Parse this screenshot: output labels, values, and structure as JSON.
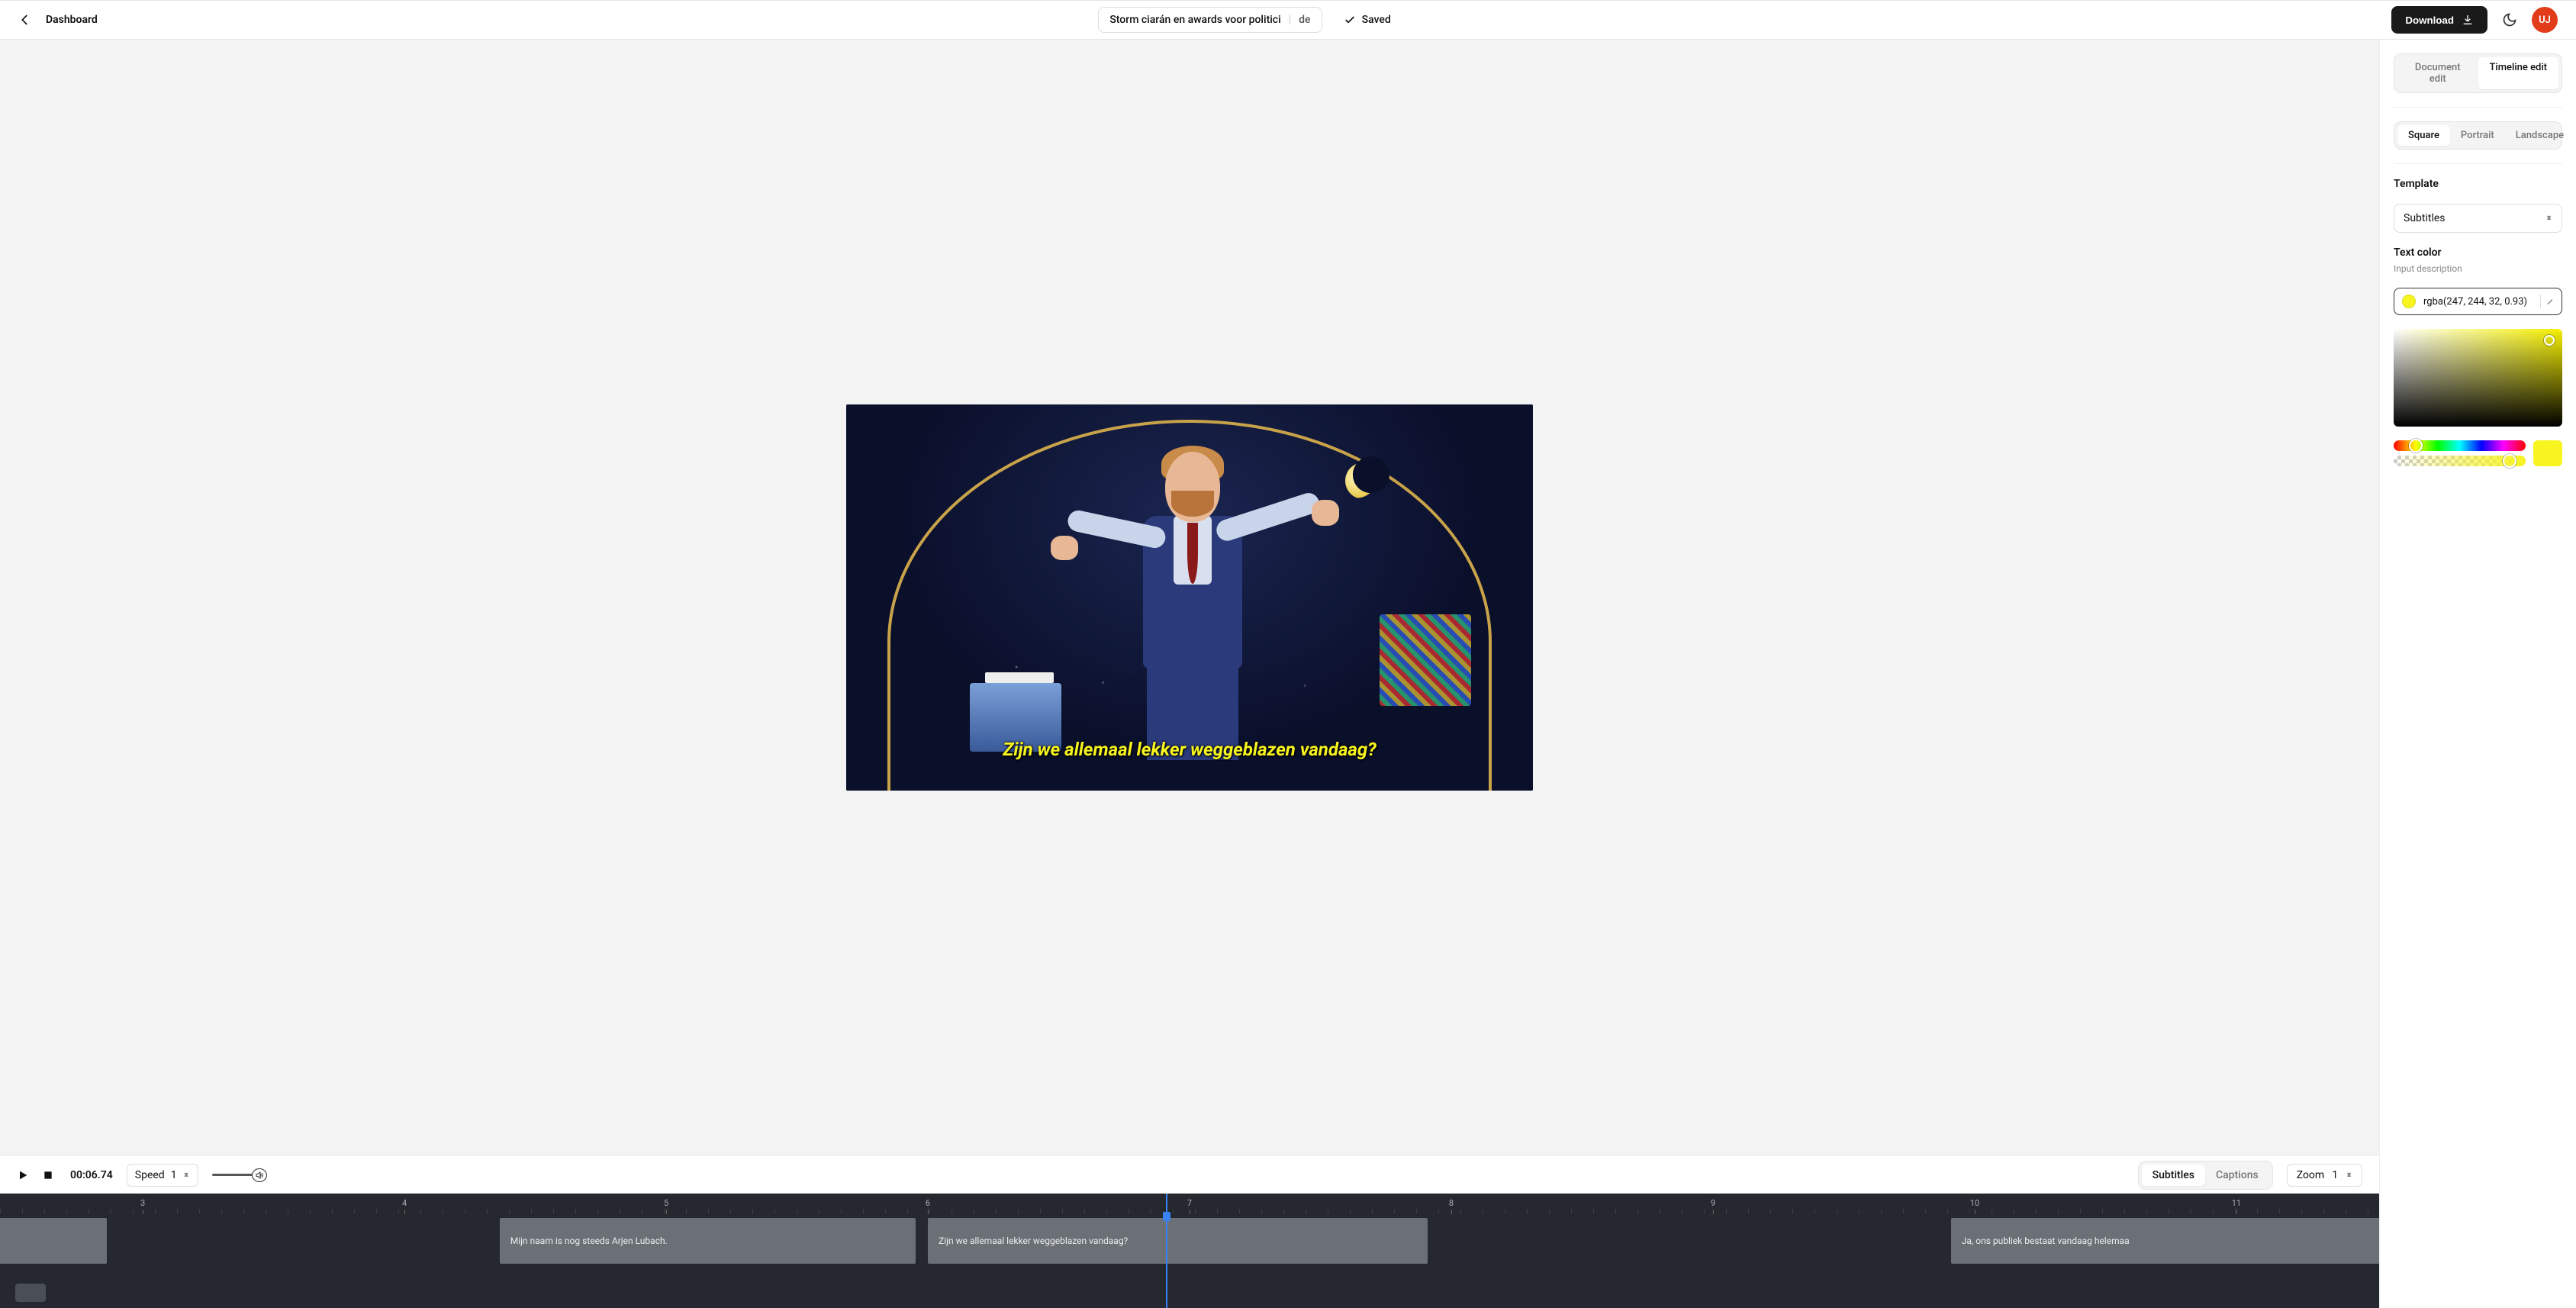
{
  "header": {
    "dashboard_label": "Dashboard",
    "project_title": "Storm ciarán en awards voor politici",
    "language": "de",
    "saved_label": "Saved",
    "download_label": "Download",
    "avatar_initials": "UJ"
  },
  "preview": {
    "subtitle_text": "Zijn we allemaal lekker weggeblazen vandaag?"
  },
  "controls": {
    "timecode": "00:06.74",
    "speed_label": "Speed",
    "speed_value": "1",
    "track_tabs": {
      "subtitles": "Subtitles",
      "captions": "Captions"
    },
    "zoom_label": "Zoom",
    "zoom_value": "1"
  },
  "timeline": {
    "ticks": [
      "3",
      "4",
      "5",
      "6",
      "7",
      "8",
      "9",
      "10",
      "11"
    ],
    "playhead_pct": 49,
    "clips": [
      {
        "text": "",
        "left_pct": 0,
        "width_pct": 4.5,
        "partial_left": true
      },
      {
        "text": "Mijn naam is nog steeds Arjen Lubach.",
        "left_pct": 21,
        "width_pct": 17.5
      },
      {
        "text": "Zijn we allemaal lekker weggeblazen vandaag?",
        "left_pct": 39,
        "width_pct": 21
      },
      {
        "text": "Ja, ons publiek bestaat vandaag helemaa",
        "left_pct": 82,
        "width_pct": 18,
        "partial_right": true
      }
    ]
  },
  "sidebar": {
    "mode_tabs": {
      "document": "Document edit",
      "timeline": "Timeline edit"
    },
    "aspect_tabs": {
      "square": "Square",
      "portrait": "Portrait",
      "landscape": "Landscape"
    },
    "template_label": "Template",
    "template_value": "Subtitles",
    "textcolor_label": "Text color",
    "textcolor_desc": "Input description",
    "textcolor_value": "rgba(247, 244, 32, 0.93)",
    "hue_marker_pct": 17,
    "alpha_marker_pct": 88
  }
}
